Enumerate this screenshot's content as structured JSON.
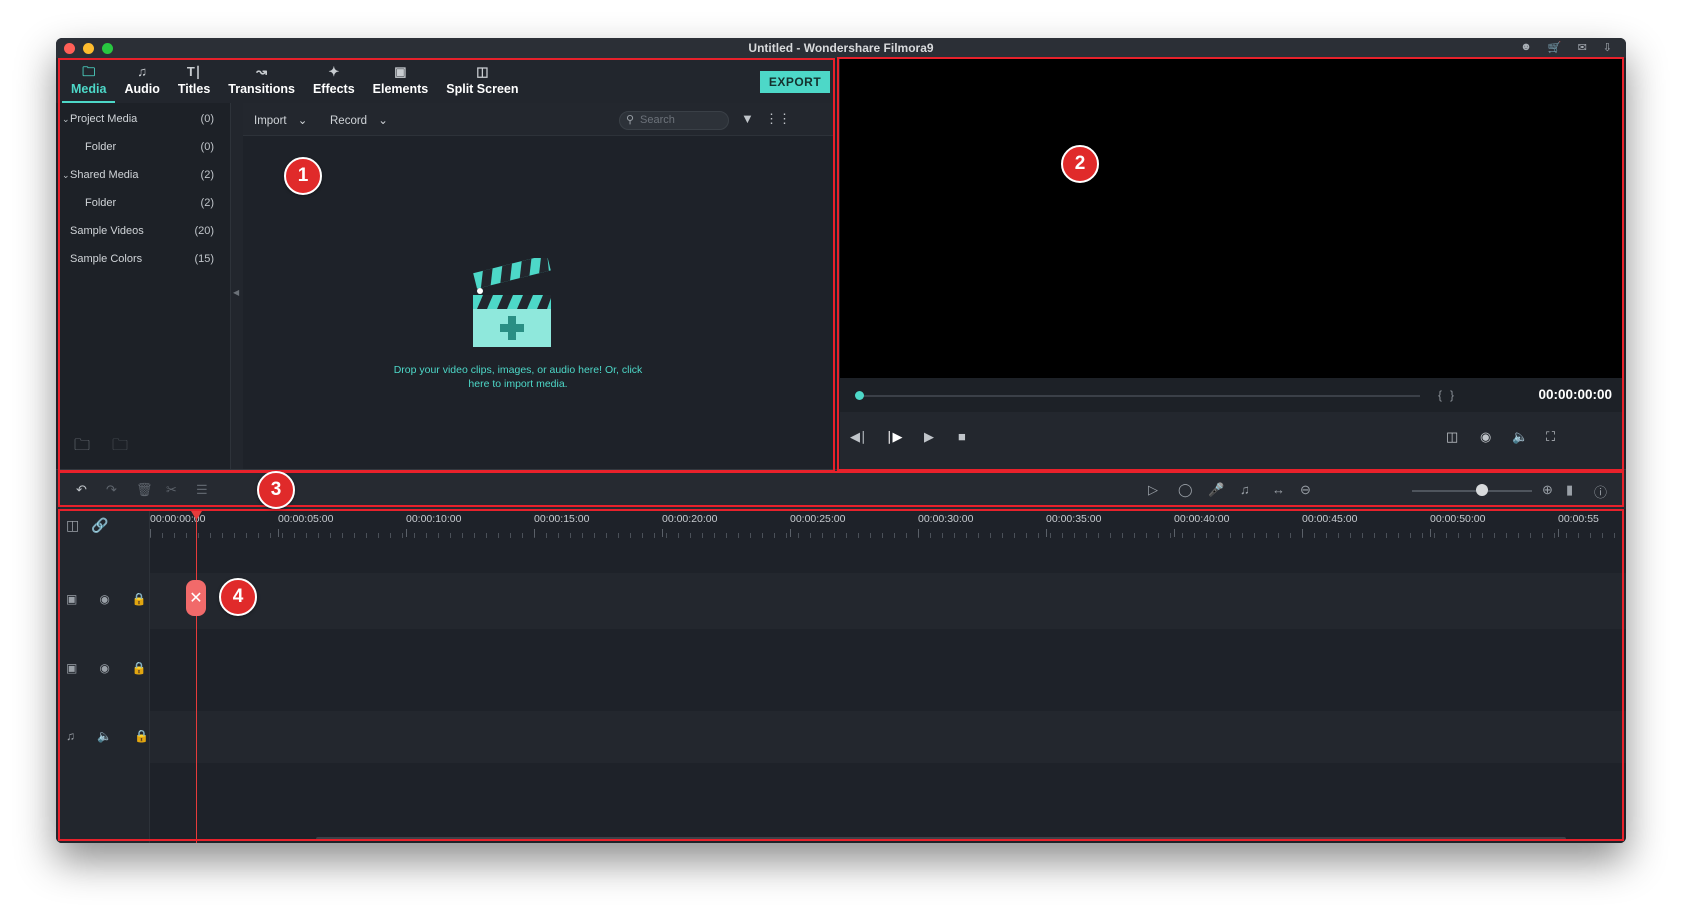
{
  "window": {
    "title": "Untitled - Wondershare Filmora9",
    "traffic_colors": [
      "#ff5f57",
      "#febc2e",
      "#28c840"
    ],
    "title_icons": [
      "user-icon",
      "cart-icon",
      "mail-icon",
      "download-icon"
    ]
  },
  "tabs": [
    {
      "label": "Media",
      "icon": "folder-icon",
      "active": true
    },
    {
      "label": "Audio",
      "icon": "music-note-icon"
    },
    {
      "label": "Titles",
      "icon": "text-icon"
    },
    {
      "label": "Transitions",
      "icon": "transitions-icon"
    },
    {
      "label": "Effects",
      "icon": "effects-icon"
    },
    {
      "label": "Elements",
      "icon": "image-icon"
    },
    {
      "label": "Split Screen",
      "icon": "split-screen-icon"
    }
  ],
  "export_label": "EXPORT",
  "sidebar": {
    "items": [
      {
        "label": "Project Media",
        "count": "(0)"
      },
      {
        "label": "Folder",
        "count": "(0)"
      },
      {
        "label": "Shared Media",
        "count": "(2)"
      },
      {
        "label": "Folder",
        "count": "(2)"
      },
      {
        "label": "Sample Videos",
        "count": "(20)"
      },
      {
        "label": "Sample Colors",
        "count": "(15)"
      }
    ]
  },
  "media_toolbar": {
    "import_label": "Import",
    "record_label": "Record",
    "search_placeholder": "Search"
  },
  "drop_text_1": "Drop your video clips, images, or audio here! Or, click",
  "drop_text_2": "here to import media.",
  "preview": {
    "timecode": "00:00:00:00"
  },
  "ruler": {
    "labels": [
      "00:00:00:00",
      "00:00:05:00",
      "00:00:10:00",
      "00:00:15:00",
      "00:00:20:00",
      "00:00:25:00",
      "00:00:30:00",
      "00:00:35:00",
      "00:00:40:00",
      "00:00:45:00",
      "00:00:50:00",
      "00:00:55"
    ]
  },
  "callouts": [
    "1",
    "2",
    "3",
    "4"
  ],
  "colors": {
    "accent": "#4dd8c8",
    "annotation_red": "#e8212b",
    "playhead": "#e63b3b"
  }
}
